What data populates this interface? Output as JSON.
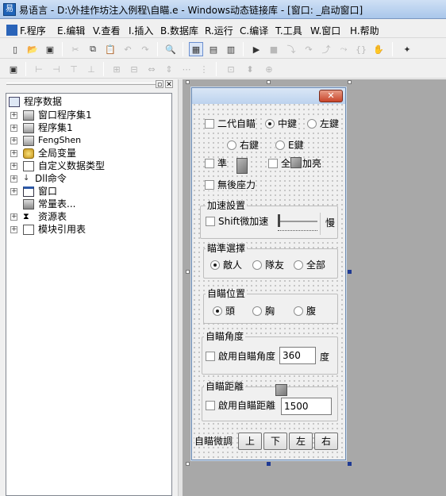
{
  "window": {
    "title": "易语言 - D:\\外挂作坊注入例程\\自瞄.e - Windows动态链接库 - [窗口: _启动窗口]"
  },
  "menu": [
    {
      "label": "F.程序"
    },
    {
      "label": "E.编辑"
    },
    {
      "label": "V.查看"
    },
    {
      "label": "I.插入"
    },
    {
      "label": "B.数据库"
    },
    {
      "label": "R.运行"
    },
    {
      "label": "C.编译"
    },
    {
      "label": "T.工具"
    },
    {
      "label": "W.窗口"
    },
    {
      "label": "H.帮助"
    }
  ],
  "tree": {
    "root": "程序数据",
    "items": [
      {
        "label": "窗口程序集1",
        "icon": "module-icon"
      },
      {
        "label": "程序集1",
        "icon": "module-icon"
      },
      {
        "label": "FengShen",
        "icon": "module-icon"
      },
      {
        "label": "全局变量",
        "icon": "globe-icon"
      },
      {
        "label": "自定义数据类型",
        "icon": "type-icon"
      },
      {
        "label": "Dll命令",
        "icon": "dll-icon"
      },
      {
        "label": "窗口",
        "icon": "window-icon"
      },
      {
        "label": "常量表...",
        "icon": "const-icon"
      },
      {
        "label": "资源表",
        "icon": "resource-icon"
      },
      {
        "label": "模块引用表",
        "icon": "module-ref-icon"
      }
    ]
  },
  "form": {
    "close_label": "✕",
    "row1": {
      "check_label": "二代自瞄",
      "radio_middle": "中鍵",
      "radio_left": "左鍵"
    },
    "row2": {
      "radio_right": "右鍵",
      "radio_e": "E鍵"
    },
    "row3": {
      "check_precise": "準",
      "check_bright": "全",
      "bright_suffix": "加亮"
    },
    "row4": {
      "check_recoil": "無後座力"
    },
    "speed": {
      "title": "加速設置",
      "check_shift": "Shift微加速",
      "slow": "慢"
    },
    "target": {
      "title": "瞄準選擇",
      "enemy": "敵人",
      "team": "隊友",
      "all": "全部"
    },
    "position": {
      "title": "自瞄位置",
      "head": "頭",
      "chest": "胸",
      "belly": "腹"
    },
    "angle": {
      "title": "自瞄角度",
      "check": "啟用自瞄角度",
      "value": "360",
      "unit": "度"
    },
    "distance": {
      "title": "自瞄距離",
      "check": "啟用自瞄距離",
      "value": "1500"
    },
    "adjust": {
      "label": "自瞄微調",
      "up": "上",
      "down": "下",
      "left": "左",
      "right": "右"
    }
  }
}
